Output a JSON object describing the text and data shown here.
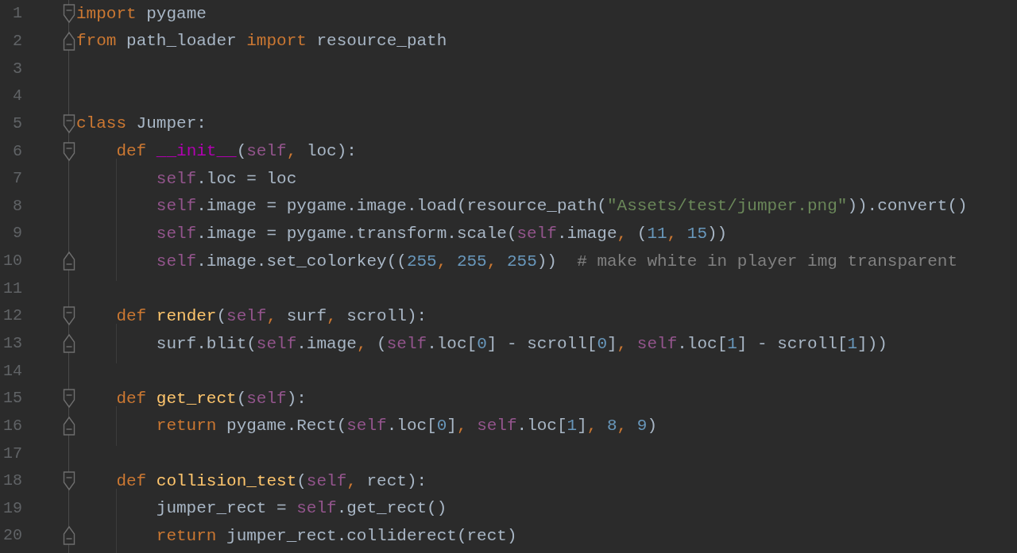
{
  "editor": {
    "lines": [
      {
        "number": "1",
        "kind": "opener",
        "tokens": [
          {
            "text": "import",
            "kind": "kw"
          },
          {
            "text": " pygame",
            "kind": "plain"
          }
        ]
      },
      {
        "number": "2",
        "kind": "closer",
        "tokens": [
          {
            "text": "from",
            "kind": "kw"
          },
          {
            "text": " path_loader ",
            "kind": "plain"
          },
          {
            "text": "import",
            "kind": "kw"
          },
          {
            "text": " resource_path",
            "kind": "plain"
          }
        ]
      },
      {
        "number": "3"
      },
      {
        "number": "4"
      },
      {
        "number": "5",
        "kind": "opener",
        "tokens": [
          {
            "text": "class",
            "kind": "kw"
          },
          {
            "text": " Jumper:",
            "kind": "plain"
          }
        ]
      },
      {
        "number": "6",
        "kind": "opener",
        "tokens": [
          {
            "text": "    def",
            "kind": "kw"
          },
          {
            "text": " __init__",
            "kind": "magic"
          },
          {
            "text": "(",
            "kind": "plain"
          },
          {
            "text": "self",
            "kind": "self"
          },
          {
            "text": ",",
            "kind": "kw"
          },
          {
            "text": " loc):",
            "kind": "plain"
          }
        ]
      },
      {
        "number": "7",
        "tokens": [
          {
            "text": "        self",
            "kind": "self"
          },
          {
            "text": ".loc = loc",
            "kind": "plain"
          }
        ]
      },
      {
        "number": "8",
        "tokens": [
          {
            "text": "        self",
            "kind": "self"
          },
          {
            "text": ".image = pygame.image.load(resource_path(",
            "kind": "plain"
          },
          {
            "text": "\"Assets/test/jumper.png\"",
            "kind": "str"
          },
          {
            "text": ")).convert()",
            "kind": "plain"
          }
        ]
      },
      {
        "number": "9",
        "tokens": [
          {
            "text": "        self",
            "kind": "self"
          },
          {
            "text": ".image = pygame.transform.scale(",
            "kind": "plain"
          },
          {
            "text": "self",
            "kind": "self"
          },
          {
            "text": ".image",
            "kind": "plain"
          },
          {
            "text": ",",
            "kind": "kw"
          },
          {
            "text": " (",
            "kind": "plain"
          },
          {
            "text": "11",
            "kind": "num"
          },
          {
            "text": ",",
            "kind": "kw"
          },
          {
            "text": " 15",
            "kind": "num"
          },
          {
            "text": "))",
            "kind": "plain"
          }
        ]
      },
      {
        "number": "10",
        "kind": "closer",
        "tokens": [
          {
            "text": "        self",
            "kind": "self"
          },
          {
            "text": ".image.set_colorkey((",
            "kind": "plain"
          },
          {
            "text": "255",
            "kind": "num"
          },
          {
            "text": ",",
            "kind": "kw"
          },
          {
            "text": " 255",
            "kind": "num"
          },
          {
            "text": ",",
            "kind": "kw"
          },
          {
            "text": " 255",
            "kind": "num"
          },
          {
            "text": "))  ",
            "kind": "plain"
          },
          {
            "text": "# make white in player img transparent",
            "kind": "comment"
          }
        ]
      },
      {
        "number": "11"
      },
      {
        "number": "12",
        "kind": "opener",
        "tokens": [
          {
            "text": "    def",
            "kind": "kw"
          },
          {
            "text": " render",
            "kind": "fn"
          },
          {
            "text": "(",
            "kind": "plain"
          },
          {
            "text": "self",
            "kind": "self"
          },
          {
            "text": ",",
            "kind": "kw"
          },
          {
            "text": " surf",
            "kind": "plain"
          },
          {
            "text": ",",
            "kind": "kw"
          },
          {
            "text": " scroll):",
            "kind": "plain"
          }
        ]
      },
      {
        "number": "13",
        "kind": "closer",
        "tokens": [
          {
            "text": "        surf.blit(",
            "kind": "plain"
          },
          {
            "text": "self",
            "kind": "self"
          },
          {
            "text": ".image",
            "kind": "plain"
          },
          {
            "text": ",",
            "kind": "kw"
          },
          {
            "text": " (",
            "kind": "plain"
          },
          {
            "text": "self",
            "kind": "self"
          },
          {
            "text": ".loc[",
            "kind": "plain"
          },
          {
            "text": "0",
            "kind": "num"
          },
          {
            "text": "] - scroll[",
            "kind": "plain"
          },
          {
            "text": "0",
            "kind": "num"
          },
          {
            "text": "]",
            "kind": "plain"
          },
          {
            "text": ",",
            "kind": "kw"
          },
          {
            "text": " self",
            "kind": "self"
          },
          {
            "text": ".loc[",
            "kind": "plain"
          },
          {
            "text": "1",
            "kind": "num"
          },
          {
            "text": "] - scroll[",
            "kind": "plain"
          },
          {
            "text": "1",
            "kind": "num"
          },
          {
            "text": "]))",
            "kind": "plain"
          }
        ]
      },
      {
        "number": "14"
      },
      {
        "number": "15",
        "kind": "opener",
        "tokens": [
          {
            "text": "    def",
            "kind": "kw"
          },
          {
            "text": " get_rect",
            "kind": "fn"
          },
          {
            "text": "(",
            "kind": "plain"
          },
          {
            "text": "self",
            "kind": "self"
          },
          {
            "text": "):",
            "kind": "plain"
          }
        ]
      },
      {
        "number": "16",
        "kind": "closer",
        "tokens": [
          {
            "text": "        return",
            "kind": "kw"
          },
          {
            "text": " pygame.Rect(",
            "kind": "plain"
          },
          {
            "text": "self",
            "kind": "self"
          },
          {
            "text": ".loc[",
            "kind": "plain"
          },
          {
            "text": "0",
            "kind": "num"
          },
          {
            "text": "]",
            "kind": "plain"
          },
          {
            "text": ",",
            "kind": "kw"
          },
          {
            "text": " self",
            "kind": "self"
          },
          {
            "text": ".loc[",
            "kind": "plain"
          },
          {
            "text": "1",
            "kind": "num"
          },
          {
            "text": "]",
            "kind": "plain"
          },
          {
            "text": ",",
            "kind": "kw"
          },
          {
            "text": " 8",
            "kind": "num"
          },
          {
            "text": ",",
            "kind": "kw"
          },
          {
            "text": " 9",
            "kind": "num"
          },
          {
            "text": ")",
            "kind": "plain"
          }
        ]
      },
      {
        "number": "17"
      },
      {
        "number": "18",
        "kind": "opener",
        "tokens": [
          {
            "text": "    def",
            "kind": "kw"
          },
          {
            "text": " collision_test",
            "kind": "fn"
          },
          {
            "text": "(",
            "kind": "plain"
          },
          {
            "text": "self",
            "kind": "self"
          },
          {
            "text": ",",
            "kind": "kw"
          },
          {
            "text": " rect):",
            "kind": "plain"
          }
        ]
      },
      {
        "number": "19",
        "tokens": [
          {
            "text": "        jumper_rect = ",
            "kind": "plain"
          },
          {
            "text": "self",
            "kind": "self"
          },
          {
            "text": ".get_rect()",
            "kind": "plain"
          }
        ]
      },
      {
        "number": "20",
        "kind": "closer",
        "tokens": [
          {
            "text": "        return",
            "kind": "kw"
          },
          {
            "text": " jumper_rect.colliderect(rect)",
            "kind": "plain"
          }
        ]
      }
    ]
  }
}
